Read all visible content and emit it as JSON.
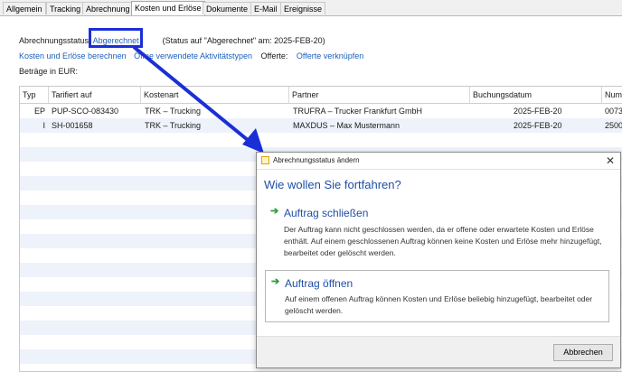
{
  "tabs": [
    {
      "label": "Allgemein"
    },
    {
      "label": "Tracking"
    },
    {
      "label": "Abrechnung"
    },
    {
      "label": "Kosten und Erlöse"
    },
    {
      "label": "Dokumente"
    },
    {
      "label": "E-Mail"
    },
    {
      "label": "Ereignisse"
    }
  ],
  "status": {
    "label": "Abrechnungsstatus:",
    "value": "Abgerechnet",
    "note": "(Status auf \"Abgerechnet\" am: 2025-FEB-20)"
  },
  "links": {
    "recalc": "Kosten und Erlöse berechnen",
    "open_activities": "Öffne verwendete Aktivitätstypen",
    "offers_label": "Offerte:",
    "link_offer": "Offerte verknüpfen"
  },
  "amounts_label": "Beträge in EUR:",
  "table": {
    "columns": [
      "Typ",
      "Tarifiert auf",
      "Kostenart",
      "Partner",
      "Buchungsdatum",
      "Num"
    ],
    "rows": [
      {
        "typ": "EP",
        "tarif": "PUP-SCO-083430",
        "kostenart": "TRK – Trucking",
        "partner": "TRUFRA – Trucker Frankfurt GmbH",
        "datum": "2025-FEB-20",
        "num": "0073"
      },
      {
        "typ": "I",
        "tarif": "SH-001658",
        "kostenart": "TRK – Trucking",
        "partner": "MAXDUS – Max Mustermann",
        "datum": "2025-FEB-20",
        "num": "2500"
      }
    ]
  },
  "dialog": {
    "title": "Abrechnungsstatus ändern",
    "heading": "Wie wollen Sie fortfahren?",
    "options": [
      {
        "title": "Auftrag schließen",
        "description": "Der Auftrag kann nicht geschlossen werden, da er offene oder erwartete Kosten und Erlöse enthält. Auf einem geschlossenen Auftrag können keine Kosten und Erlöse mehr hinzugefügt, bearbeitet oder gelöscht werden."
      },
      {
        "title": "Auftrag öffnen",
        "description": "Auf einem offenen Auftrag können Kosten und Erlöse beliebig hinzugefügt, bearbeitet oder gelöscht werden."
      }
    ],
    "cancel_label": "Abbrechen",
    "close_icon": "close-icon"
  },
  "colors": {
    "highlight": "#1b2fd6",
    "link": "#1e5fb8",
    "heading": "#1f4ea3",
    "option_arrow": "#2e9c3b"
  }
}
